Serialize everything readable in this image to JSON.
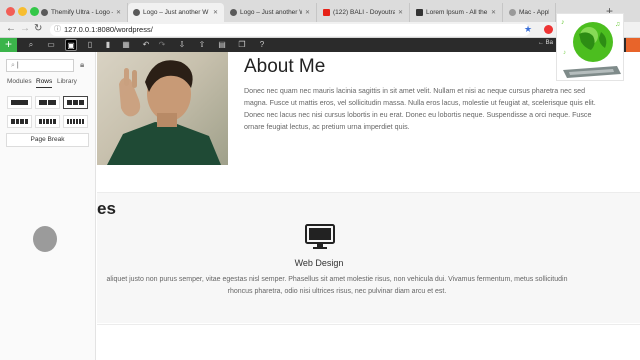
{
  "browser": {
    "tabs": [
      {
        "label": "Themify Ultra - Logo –",
        "favicon_color": "#5a5a5a"
      },
      {
        "label": "Logo – Just another W",
        "favicon_color": "#5a5a5a"
      },
      {
        "label": "Logo – Just another W",
        "favicon_color": "#5a5a5a"
      },
      {
        "label": "(122) BALI - Doyoutrave",
        "favicon_color": "#e62117"
      },
      {
        "label": "Lorem Ipsum - All the f",
        "favicon_color": "#333333"
      },
      {
        "label": "Mac - Apple",
        "favicon_color": "#999999"
      }
    ],
    "url": "127.0.0.1:8080/wordpress/"
  },
  "toolbar": {
    "add_label": "+",
    "back_label": "Ba",
    "accent": "#3bb44a"
  },
  "panel": {
    "search_value": "|",
    "tabs": [
      "Modules",
      "Rows",
      "Library"
    ],
    "page_break_label": "Page Break"
  },
  "about": {
    "title": "About Me",
    "body": "Donec nec quam nec mauris lacinia sagittis in sit amet velit. Nullam et nisi ac neque cursus pharetra nec sed magna. Fusce ut mattis eros, vel sollicitudin massa. Nulla eros lacus, molestie ut feugiat at, scelerisque quis elit. Donec nec lacus nec nisi cursus lobortis in eu erat. Donec eu lobortis neque. Suspendisse a orci neque. Fusce ornare feugiat lectus, ac pretium urna imperdiet quis."
  },
  "services": {
    "title": "es",
    "item_title": "Web Design",
    "item_body": "aliquet justo non purus semper, vitae egestas nisl semper. Phasellus sit amet molestie risus, non vehicula dui. Vivamus fermentum, metus sollicitudin rhoncus pharetra, odio nisi ultrices risus, nec pulvinar diam arcu et est."
  }
}
